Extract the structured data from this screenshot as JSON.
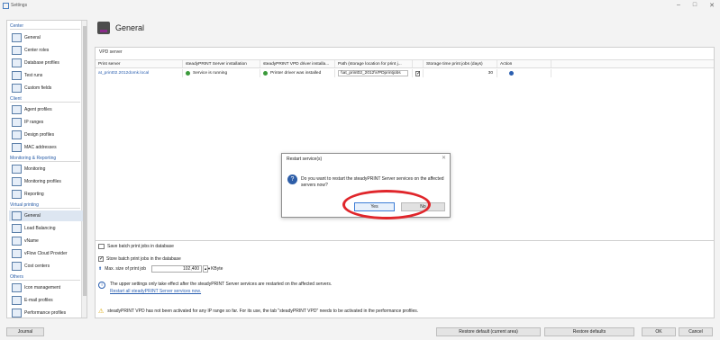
{
  "window": {
    "title": "Settings",
    "minimize": "–",
    "maximize": "□",
    "close": "✕"
  },
  "sidebar": {
    "groups": {
      "center": "Center",
      "client": "Client",
      "monitoring": "Monitoring & Reporting",
      "virtual": "Virtual printing",
      "others": "Others"
    },
    "items": [
      {
        "label": "General"
      },
      {
        "label": "Center roles"
      },
      {
        "label": "Database profiles"
      },
      {
        "label": "Test runs"
      },
      {
        "label": "Custom fields"
      },
      {
        "label": "Agent profiles"
      },
      {
        "label": "IP ranges"
      },
      {
        "label": "Design profiles"
      },
      {
        "label": "MAC addresses"
      },
      {
        "label": "Monitoring"
      },
      {
        "label": "Monitoring profiles"
      },
      {
        "label": "Reporting"
      },
      {
        "label": "General"
      },
      {
        "label": "Load Balancing"
      },
      {
        "label": "vName"
      },
      {
        "label": "vFlow Cloud Provider"
      },
      {
        "label": "Cost centers"
      },
      {
        "label": "Icon management"
      },
      {
        "label": "E-mail profiles"
      },
      {
        "label": "Performance profiles"
      }
    ]
  },
  "main": {
    "title": "General",
    "vpd_section": "VPD server",
    "columns": [
      "Print server",
      "steadyPRINT Server installation",
      "steadyPRINT VPD driver installa...",
      "",
      "Path (storage location for print j...",
      "",
      "Storage time print jobs (days)",
      "Action"
    ],
    "row": {
      "server": "at_print02.2012domk.local",
      "server_install": "Service is running",
      "driver_install": "Printer driver was installed",
      "path": "\\\\at_print02_2012\\VPDprintjobs",
      "days": "30"
    },
    "save": {
      "header": "Save batch print jobs in database",
      "store_label": "Store batch print jobs in the database",
      "max_size_label": "Max. size of print job",
      "max_size_value": "102,400",
      "max_size_unit": "KByte"
    },
    "info_text": "The upper settings only take effect after the steadyPRINT Server services are restarted on the affected servers.",
    "restart_link": "Restart all steadyPRINT Server services now.",
    "warning_text": "steadyPRINT VPD has not been activated for any IP range so far. For its use, the tab \"steadyPRINT VPD\" needs to be activated in the performance profiles."
  },
  "footer": {
    "journal": "Journal",
    "restore_current": "Restore default (current area)",
    "restore_defaults": "Restore defaults",
    "ok": "OK",
    "cancel": "Cancel"
  },
  "dialog": {
    "title": "Restart service(s)",
    "message": "Do you want to restart the steadyPRINT Server services on the affected servers now?",
    "yes": "Yes",
    "no": "No",
    "close": "✕"
  },
  "colors": {
    "accent": "#2b5fb0",
    "highlight": "#e0262b",
    "selected": "#dde6f1"
  }
}
